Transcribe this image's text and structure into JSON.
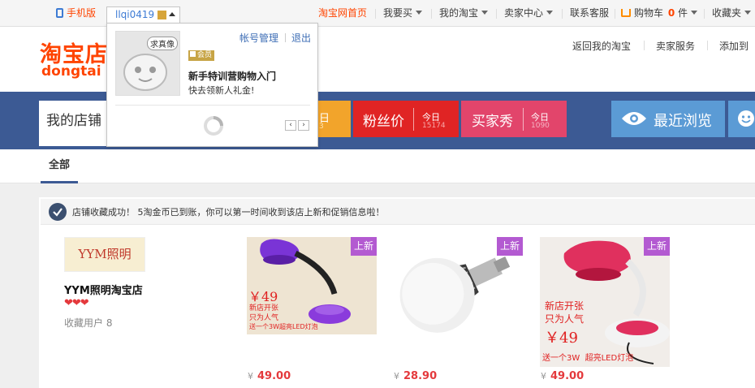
{
  "topbar": {
    "mobile_label": "手机版",
    "username": "llqi0419",
    "taobao_home": "淘宝网首页",
    "want_buy": "我要买",
    "my_taobao": "我的淘宝",
    "seller_center": "卖家中心",
    "contact_service": "联系客服",
    "cart_label": "购物车",
    "cart_count": "0",
    "cart_unit": "件",
    "favorites": "收藏夹"
  },
  "header": {
    "logo_cn": "淘宝店",
    "logo_en": "dongtai",
    "back_my_taobao": "返回我的淘宝",
    "seller_service": "卖家服务",
    "add_to": "添加到"
  },
  "banner": {
    "my_shop": "我的店铺",
    "tab1_frag_small": "日",
    "tab1_frag_num": "3",
    "fans_price": "粉丝价",
    "fans_today": "今日",
    "fans_count": "15174",
    "buyer_show": "买家秀",
    "buyer_today": "今日",
    "buyer_count": "1090",
    "recent_browse": "最近浏览"
  },
  "tabs": {
    "all": "全部"
  },
  "notice": {
    "text": "店铺收藏成功！ 5淘金币已到账，你可以第一时间收到该店上新和促销信息啦！"
  },
  "shop": {
    "logo_text": "YYM照明",
    "name": "YYM照明淘宝店",
    "hearts": "❤❤❤",
    "collectors": "收藏用户 8"
  },
  "products": [
    {
      "tag": "上新",
      "currency": "¥",
      "price": "49.00",
      "promo_price": "￥49",
      "promo_line1": "新店开张",
      "promo_line2": "只为人气",
      "promo_line3": "送一个3W超亮LED灯泡"
    },
    {
      "tag": "上新",
      "currency": "¥",
      "price": "28.90"
    },
    {
      "tag": "上新",
      "currency": "¥",
      "price": "49.00",
      "promo_price": "￥49",
      "promo_line1": "新店开张",
      "promo_line2": "只为人气",
      "promo_line3": "送一个3W  超亮LED灯泡"
    }
  ],
  "popup": {
    "avatar_bubble": "求真像",
    "account_mgmt": "帐号管理",
    "logout": "退出",
    "member_badge": "会员",
    "title": "新手特训营购物入门",
    "subtitle": "快去领新人礼金!"
  },
  "colors": {
    "brand_orange": "#ff4400",
    "band_blue": "#3c5a94",
    "fans_red": "#e02424",
    "buyer_pink": "#e2456b",
    "recent_blue": "#5b9bd5",
    "tag_purple": "#b35ad1",
    "price_red": "#e4393c"
  }
}
